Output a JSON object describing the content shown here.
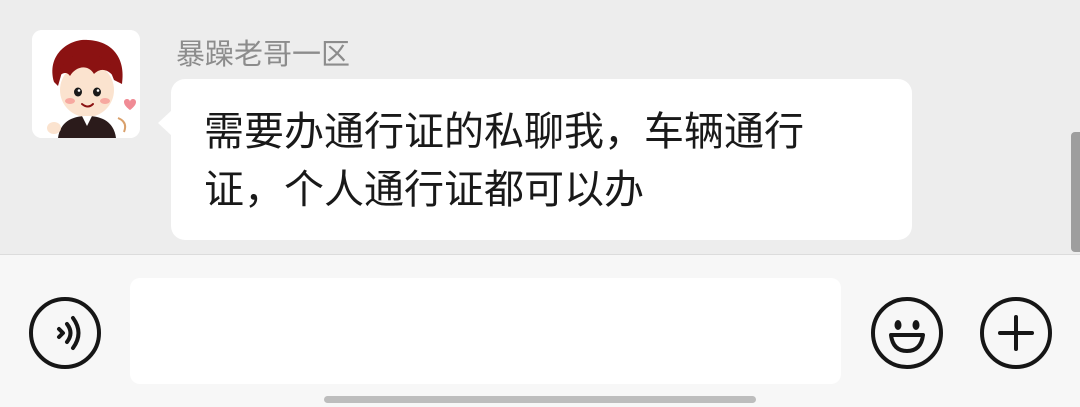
{
  "chat": {
    "messages": [
      {
        "sender_name": "暴躁老哥一区",
        "avatar": "cartoon-boy-avatar",
        "line1": "需要办通行证的私聊我，车辆通行",
        "line2": "证，个人通行证都可以办"
      }
    ]
  },
  "input_bar": {
    "text_value": "",
    "icons": {
      "voice": "voice-icon",
      "emoji": "smiley-emoji-icon",
      "more": "plus-icon"
    }
  },
  "colors": {
    "chat_background": "#ededed",
    "bubble_background": "#ffffff",
    "input_bar_background": "#f7f7f7",
    "sender_name": "#8c8c8c",
    "message_text": "#191919",
    "icon_stroke": "#161616"
  }
}
